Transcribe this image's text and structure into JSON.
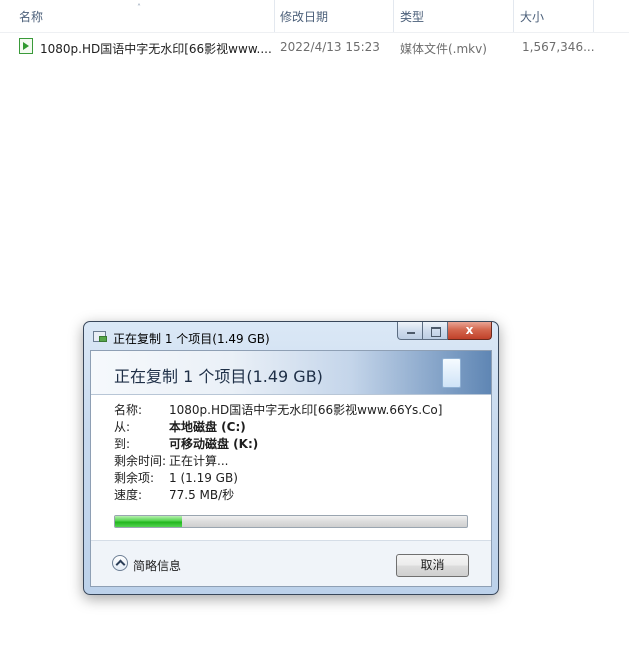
{
  "explorer": {
    "columns": {
      "name": "名称",
      "date": "修改日期",
      "type": "类型",
      "size": "大小"
    },
    "sort_indicator": "˄",
    "files": [
      {
        "name": "1080p.HD国语中字无水印[66影视www....",
        "date": "2022/4/13 15:23",
        "type": "媒体文件(.mkv)",
        "size": "1,567,346..."
      }
    ],
    "file_icon": "video-file-icon"
  },
  "dialog": {
    "window_title": "正在复制 1 个项目(1.49 GB)",
    "banner_title": "正在复制 1 个项目(1.49 GB)",
    "close_glyph": "x",
    "rows": {
      "name": {
        "label": "名称:",
        "value": "1080p.HD国语中字无水印[66影视www.66Ys.Co]"
      },
      "from": {
        "label": "从:",
        "value": "本地磁盘 (C:)"
      },
      "to": {
        "label": "到:",
        "value": "可移动磁盘 (K:)"
      },
      "remaining": {
        "label": "剩余时间:",
        "value": "正在计算..."
      },
      "items": {
        "label": "剩余项:",
        "value": "1 (1.19 GB)"
      },
      "speed": {
        "label": "速度:",
        "value": "77.5 MB/秒"
      }
    },
    "progress_fraction": 0.19,
    "progress_color": "#22b51e",
    "more_info_label": "简略信息",
    "cancel_label": "取消"
  }
}
